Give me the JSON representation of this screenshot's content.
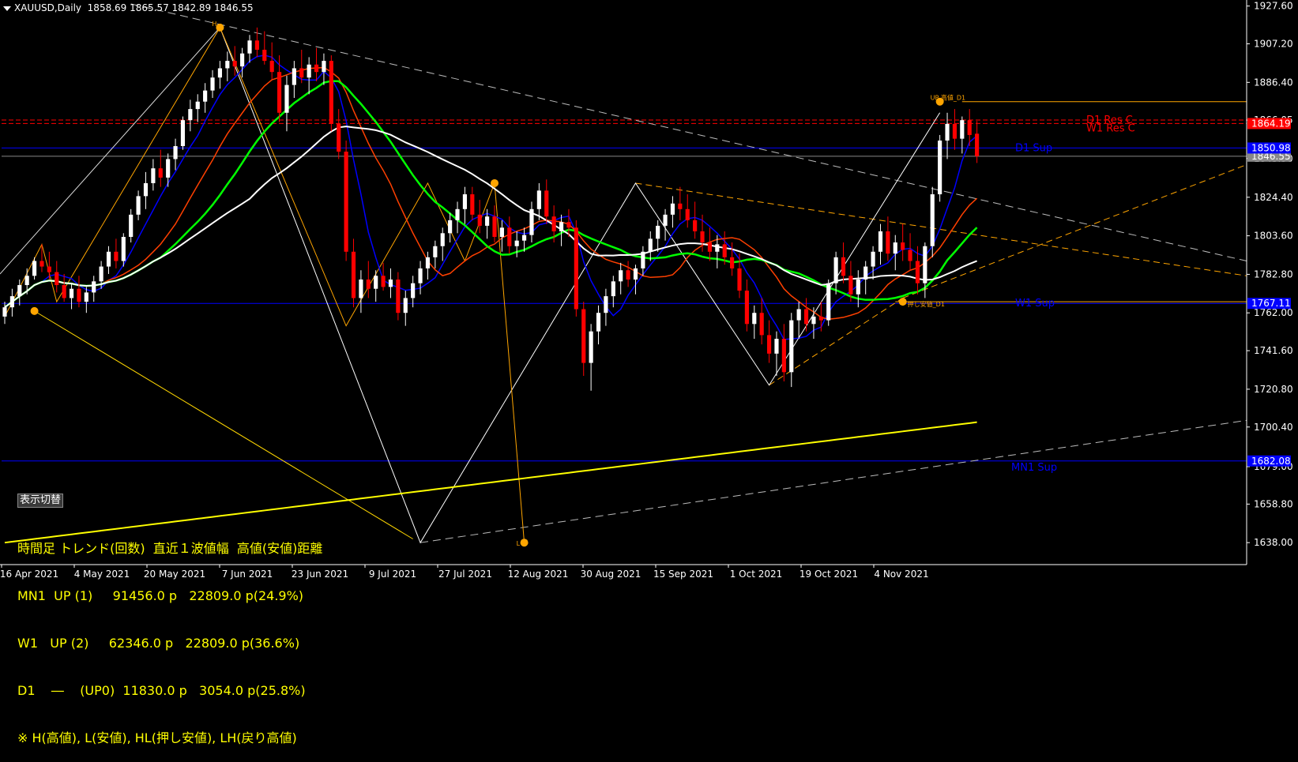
{
  "header": {
    "symbol": "XAUUSD,Daily",
    "ohlc": "1858.69 1865.57 1842.89 1846.55"
  },
  "panel": {
    "toggle_label": "表示切替",
    "rows": [
      "時間足 トレンド(回数)  直近１波値幅  高値(安値)距離",
      "MN1  UP (1)     91456.0 p   22809.0 p(24.9%)",
      "W1   UP (2)     62346.0 p   22809.0 p(36.6%)",
      "D1    ―    (UP0)  11830.0 p   3054.0 p(25.8%)",
      "※ H(高値), L(安値), HL(押し安値), LH(戻り高値)"
    ]
  },
  "colors": {
    "background": "#000000",
    "bull": "#ffffff",
    "bear": "#ff0000",
    "grid_text": "#ffffff",
    "ma_fast": "#0000ff",
    "ma_mid": "#ff4000",
    "ma_slow": "#00ff00",
    "ma_long": "#ffffff",
    "ma_200": "#ffff00",
    "resistance": "#ff0000",
    "support": "#0000ff",
    "zigzag": "#ffa500"
  },
  "chart_data": {
    "type": "candlestick",
    "symbol": "XAUUSD",
    "timeframe": "Daily",
    "ylim": [
      1627.0,
      1930.0
    ],
    "y_ticks": [
      "1927.60",
      "1907.20",
      "1886.40",
      "1866.05",
      "1845.30",
      "1824.40",
      "1803.60",
      "1782.80",
      "1762.00",
      "1741.60",
      "1720.80",
      "1700.40",
      "1679.00",
      "1658.80",
      "1638.00"
    ],
    "x_tick_labels": [
      "16 Apr 2021",
      "4 May 2021",
      "20 May 2021",
      "7 Jun 2021",
      "23 Jun 2021",
      "9 Jul 2021",
      "27 Jul 2021",
      "12 Aug 2021",
      "30 Aug 2021",
      "15 Sep 2021",
      "1 Oct 2021",
      "19 Oct 2021",
      "4 Nov 2021"
    ],
    "price_labels": {
      "res_upper": "1866.05",
      "res_lower": "1864.19",
      "d1_sup": "1850.98",
      "current": "1846.55",
      "w1_sup": "1767.11",
      "mn_sup": "1682.08"
    },
    "level_labels": {
      "d1_res": "D1 Res C",
      "w1_res": "W1 Res C",
      "d1_sup": "D1 Sup",
      "w1_sup": "W1 Sup",
      "mn_sup": "MN1 Sup"
    },
    "annotations": {
      "top_high": "H",
      "low_mark": "L",
      "recent_high": "UP 高値_D1",
      "recent_low": "押し安値_D1"
    },
    "candles": [
      [
        1760,
        1768,
        1756,
        1765
      ],
      [
        1765,
        1775,
        1760,
        1771
      ],
      [
        1771,
        1780,
        1766,
        1777
      ],
      [
        1777,
        1786,
        1772,
        1782
      ],
      [
        1782,
        1792,
        1780,
        1790
      ],
      [
        1790,
        1799,
        1784,
        1787
      ],
      [
        1787,
        1795,
        1780,
        1784
      ],
      [
        1784,
        1790,
        1773,
        1777
      ],
      [
        1777,
        1783,
        1768,
        1770
      ],
      [
        1770,
        1778,
        1764,
        1775
      ],
      [
        1775,
        1782,
        1765,
        1768
      ],
      [
        1768,
        1776,
        1762,
        1773
      ],
      [
        1773,
        1782,
        1768,
        1779
      ],
      [
        1779,
        1790,
        1775,
        1787
      ],
      [
        1787,
        1798,
        1783,
        1795
      ],
      [
        1795,
        1802,
        1786,
        1790
      ],
      [
        1790,
        1805,
        1787,
        1803
      ],
      [
        1803,
        1818,
        1800,
        1815
      ],
      [
        1815,
        1828,
        1812,
        1825
      ],
      [
        1825,
        1838,
        1818,
        1832
      ],
      [
        1832,
        1845,
        1828,
        1840
      ],
      [
        1840,
        1850,
        1830,
        1835
      ],
      [
        1835,
        1848,
        1830,
        1845
      ],
      [
        1845,
        1856,
        1839,
        1852
      ],
      [
        1852,
        1868,
        1850,
        1866
      ],
      [
        1866,
        1877,
        1860,
        1872
      ],
      [
        1872,
        1880,
        1865,
        1876
      ],
      [
        1876,
        1886,
        1870,
        1882
      ],
      [
        1882,
        1893,
        1878,
        1889
      ],
      [
        1889,
        1898,
        1883,
        1894
      ],
      [
        1894,
        1903,
        1887,
        1898
      ],
      [
        1898,
        1906,
        1890,
        1895
      ],
      [
        1895,
        1905,
        1889,
        1902
      ],
      [
        1902,
        1912,
        1897,
        1909
      ],
      [
        1909,
        1916,
        1900,
        1904
      ],
      [
        1904,
        1914,
        1896,
        1898
      ],
      [
        1898,
        1908,
        1888,
        1892
      ],
      [
        1892,
        1901,
        1865,
        1870
      ],
      [
        1870,
        1890,
        1860,
        1885
      ],
      [
        1885,
        1898,
        1878,
        1894
      ],
      [
        1894,
        1904,
        1886,
        1889
      ],
      [
        1889,
        1900,
        1880,
        1896
      ],
      [
        1896,
        1905,
        1887,
        1892
      ],
      [
        1892,
        1902,
        1885,
        1898
      ],
      [
        1898,
        1901,
        1860,
        1864
      ],
      [
        1864,
        1872,
        1845,
        1849
      ],
      [
        1849,
        1855,
        1790,
        1795
      ],
      [
        1795,
        1802,
        1765,
        1770
      ],
      [
        1770,
        1785,
        1762,
        1780
      ],
      [
        1780,
        1790,
        1770,
        1775
      ],
      [
        1775,
        1785,
        1768,
        1782
      ],
      [
        1782,
        1789,
        1774,
        1776
      ],
      [
        1776,
        1786,
        1770,
        1780
      ],
      [
        1780,
        1784,
        1758,
        1762
      ],
      [
        1762,
        1774,
        1755,
        1770
      ],
      [
        1770,
        1782,
        1765,
        1778
      ],
      [
        1778,
        1790,
        1772,
        1786
      ],
      [
        1786,
        1795,
        1780,
        1792
      ],
      [
        1792,
        1801,
        1786,
        1798
      ],
      [
        1798,
        1808,
        1790,
        1805
      ],
      [
        1805,
        1816,
        1800,
        1812
      ],
      [
        1812,
        1822,
        1805,
        1818
      ],
      [
        1818,
        1830,
        1810,
        1826
      ],
      [
        1826,
        1830,
        1812,
        1815
      ],
      [
        1815,
        1823,
        1805,
        1809
      ],
      [
        1809,
        1818,
        1802,
        1814
      ],
      [
        1814,
        1820,
        1800,
        1803
      ],
      [
        1803,
        1812,
        1795,
        1808
      ],
      [
        1808,
        1814,
        1794,
        1798
      ],
      [
        1798,
        1806,
        1792,
        1801
      ],
      [
        1801,
        1808,
        1795,
        1804
      ],
      [
        1804,
        1822,
        1800,
        1818
      ],
      [
        1818,
        1832,
        1812,
        1828
      ],
      [
        1828,
        1834,
        1810,
        1814
      ],
      [
        1814,
        1820,
        1800,
        1806
      ],
      [
        1806,
        1815,
        1798,
        1811
      ],
      [
        1811,
        1818,
        1803,
        1808
      ],
      [
        1808,
        1812,
        1760,
        1764
      ],
      [
        1764,
        1768,
        1728,
        1735
      ],
      [
        1735,
        1756,
        1720,
        1752
      ],
      [
        1752,
        1766,
        1745,
        1762
      ],
      [
        1762,
        1775,
        1755,
        1771
      ],
      [
        1771,
        1782,
        1765,
        1779
      ],
      [
        1779,
        1789,
        1772,
        1785
      ],
      [
        1785,
        1790,
        1776,
        1780
      ],
      [
        1780,
        1788,
        1772,
        1786
      ],
      [
        1786,
        1798,
        1782,
        1795
      ],
      [
        1795,
        1806,
        1790,
        1802
      ],
      [
        1802,
        1812,
        1795,
        1809
      ],
      [
        1809,
        1818,
        1801,
        1815
      ],
      [
        1815,
        1825,
        1808,
        1821
      ],
      [
        1821,
        1830,
        1812,
        1818
      ],
      [
        1818,
        1826,
        1808,
        1812
      ],
      [
        1812,
        1822,
        1802,
        1806
      ],
      [
        1806,
        1815,
        1795,
        1800
      ],
      [
        1800,
        1808,
        1790,
        1795
      ],
      [
        1795,
        1804,
        1786,
        1799
      ],
      [
        1799,
        1806,
        1788,
        1792
      ],
      [
        1792,
        1800,
        1782,
        1786
      ],
      [
        1786,
        1794,
        1770,
        1774
      ],
      [
        1774,
        1780,
        1752,
        1756
      ],
      [
        1756,
        1766,
        1748,
        1762
      ],
      [
        1762,
        1770,
        1745,
        1750
      ],
      [
        1750,
        1758,
        1735,
        1740
      ],
      [
        1740,
        1752,
        1728,
        1748
      ],
      [
        1748,
        1756,
        1725,
        1730
      ],
      [
        1730,
        1762,
        1722,
        1758
      ],
      [
        1758,
        1768,
        1748,
        1764
      ],
      [
        1764,
        1770,
        1752,
        1756
      ],
      [
        1756,
        1765,
        1748,
        1760
      ],
      [
        1760,
        1768,
        1752,
        1758
      ],
      [
        1758,
        1780,
        1755,
        1778
      ],
      [
        1778,
        1795,
        1772,
        1792
      ],
      [
        1792,
        1800,
        1778,
        1782
      ],
      [
        1782,
        1790,
        1768,
        1772
      ],
      [
        1772,
        1785,
        1765,
        1780
      ],
      [
        1780,
        1790,
        1772,
        1787
      ],
      [
        1787,
        1798,
        1780,
        1795
      ],
      [
        1795,
        1810,
        1788,
        1806
      ],
      [
        1806,
        1814,
        1790,
        1794
      ],
      [
        1794,
        1804,
        1785,
        1800
      ],
      [
        1800,
        1810,
        1790,
        1796
      ],
      [
        1796,
        1805,
        1785,
        1790
      ],
      [
        1790,
        1798,
        1772,
        1778
      ],
      [
        1778,
        1800,
        1770,
        1798
      ],
      [
        1798,
        1830,
        1792,
        1826
      ],
      [
        1826,
        1858,
        1822,
        1855
      ],
      [
        1855,
        1870,
        1845,
        1864
      ],
      [
        1864,
        1872,
        1850,
        1856
      ],
      [
        1856,
        1868,
        1848,
        1866
      ],
      [
        1866,
        1872,
        1852,
        1858
      ],
      [
        1858.69,
        1865.57,
        1842.89,
        1846.55
      ]
    ]
  }
}
